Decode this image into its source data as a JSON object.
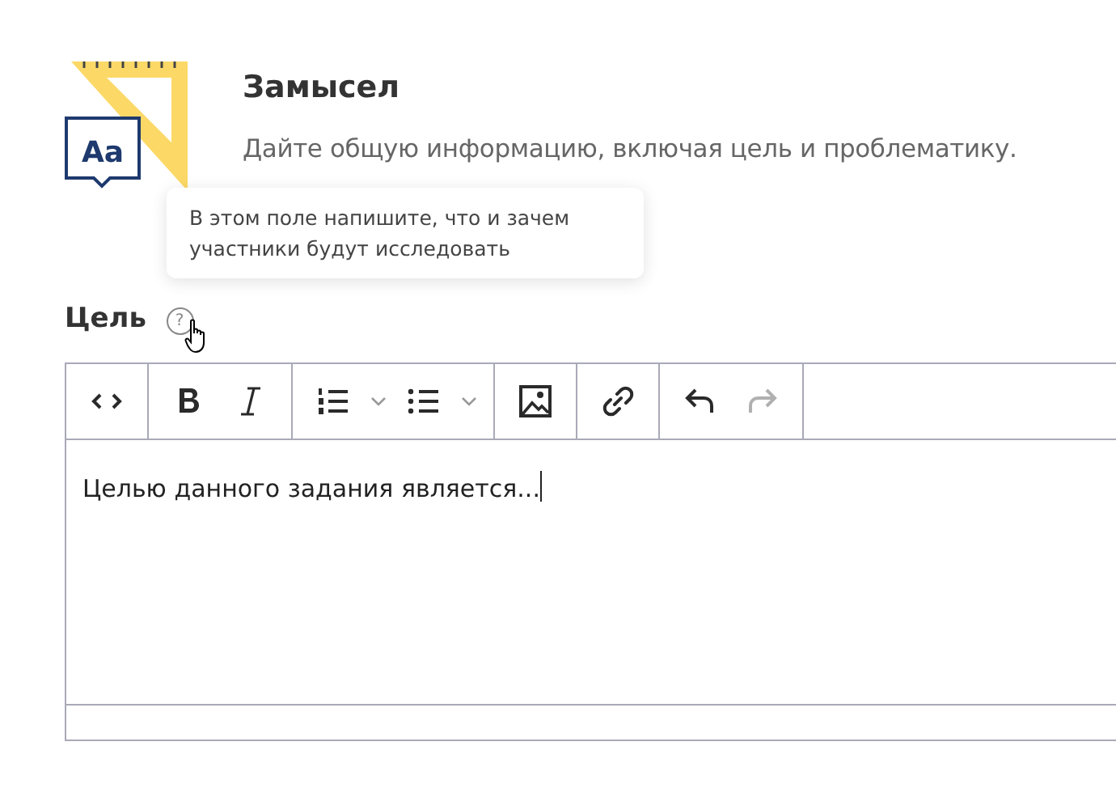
{
  "section": {
    "title": "Замысел",
    "description": "Дайте общую информацию, включая цель и проблематику."
  },
  "tooltip": {
    "text": "В этом поле напишите, что и зачем участники будут исследовать"
  },
  "icon_text": "Aa",
  "field": {
    "label": "Цель",
    "help": "?"
  },
  "toolbar": [
    [
      {
        "kind": "code",
        "disabled": false
      }
    ],
    [
      {
        "kind": "bold",
        "disabled": false
      },
      {
        "kind": "italic",
        "disabled": false
      }
    ],
    [
      {
        "kind": "ordered-list",
        "disabled": false
      },
      {
        "kind": "dropdown",
        "disabled": false
      },
      {
        "kind": "bullet-list",
        "disabled": false
      },
      {
        "kind": "dropdown",
        "disabled": false
      }
    ],
    [
      {
        "kind": "image",
        "disabled": false
      }
    ],
    [
      {
        "kind": "link",
        "disabled": false
      }
    ],
    [
      {
        "kind": "undo",
        "disabled": false
      },
      {
        "kind": "redo",
        "disabled": true
      }
    ]
  ],
  "editor": {
    "value": "Целью данного задания является..."
  }
}
